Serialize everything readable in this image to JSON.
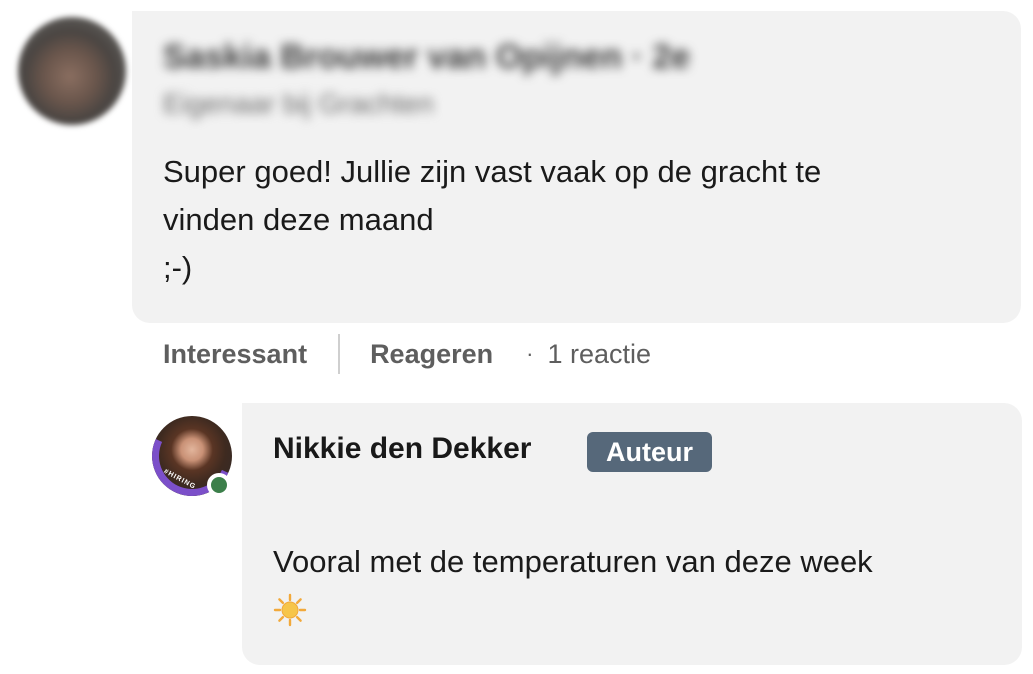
{
  "comment": {
    "author_name": "Saskia Brouwer van Opijnen · 2e",
    "author_subtitle": "Eigenaar bij Grachten",
    "text_lines": [
      "Super goed! Jullie zijn vast vaak op de gracht te",
      "vinden deze maand",
      ";-)"
    ],
    "actions": {
      "like_label": "Interessant",
      "reply_label": "Reageren",
      "separator_dot": "·",
      "reply_count": "1 reactie"
    }
  },
  "reply": {
    "author_name": "Nikkie den Dekker",
    "author_badge": "Auteur",
    "avatar_frame_text": "#HIRING",
    "text": "Vooral met de temperaturen van deze week",
    "emoji_icon": "sun-emoji-icon",
    "online_status_color": "#3c7f4a"
  },
  "colors": {
    "bubble_bg": "#f2f2f2",
    "badge_bg": "#56687a",
    "hiring_ring": "#7b4fc9"
  }
}
